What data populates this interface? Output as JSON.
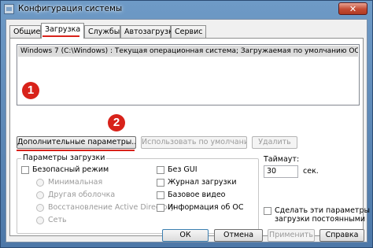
{
  "window": {
    "title": "Конфигурация системы",
    "close_glyph": "✕"
  },
  "tabs": [
    {
      "label": "Общие",
      "active": false
    },
    {
      "label": "Загрузка",
      "active": true
    },
    {
      "label": "Службы",
      "active": false
    },
    {
      "label": "Автозагрузка",
      "active": false
    },
    {
      "label": "Сервис",
      "active": false
    }
  ],
  "os_list": {
    "items": [
      "Windows 7 (C:\\Windows) : Текущая операционная система; Загружаемая по умолчанию ОС"
    ]
  },
  "badges": [
    "1",
    "2"
  ],
  "actions": {
    "advanced": "Дополнительные параметры...",
    "set_default": "Использовать по умолчанию",
    "delete": "Удалить"
  },
  "boot_options": {
    "title": "Параметры загрузки",
    "safe_mode": "Безопасный режим",
    "radios": [
      "Минимальная",
      "Другая оболочка",
      "Восстановление Active Directory",
      "Сеть"
    ],
    "right_checks": [
      "Без GUI",
      "Журнал загрузки",
      "Базовое видео",
      "Информация об ОС"
    ]
  },
  "timeout": {
    "label": "Таймаут:",
    "value": "30",
    "unit": "сек."
  },
  "permanent": {
    "line1": "Сделать эти параметры",
    "line2": "загрузки постоянными"
  },
  "footer": {
    "ok": "ОК",
    "cancel": "Отмена",
    "apply": "Применить",
    "help": "Справка"
  },
  "colors": {
    "annotation_red": "#d8221a",
    "title_gradient": "#6e9ac6"
  }
}
